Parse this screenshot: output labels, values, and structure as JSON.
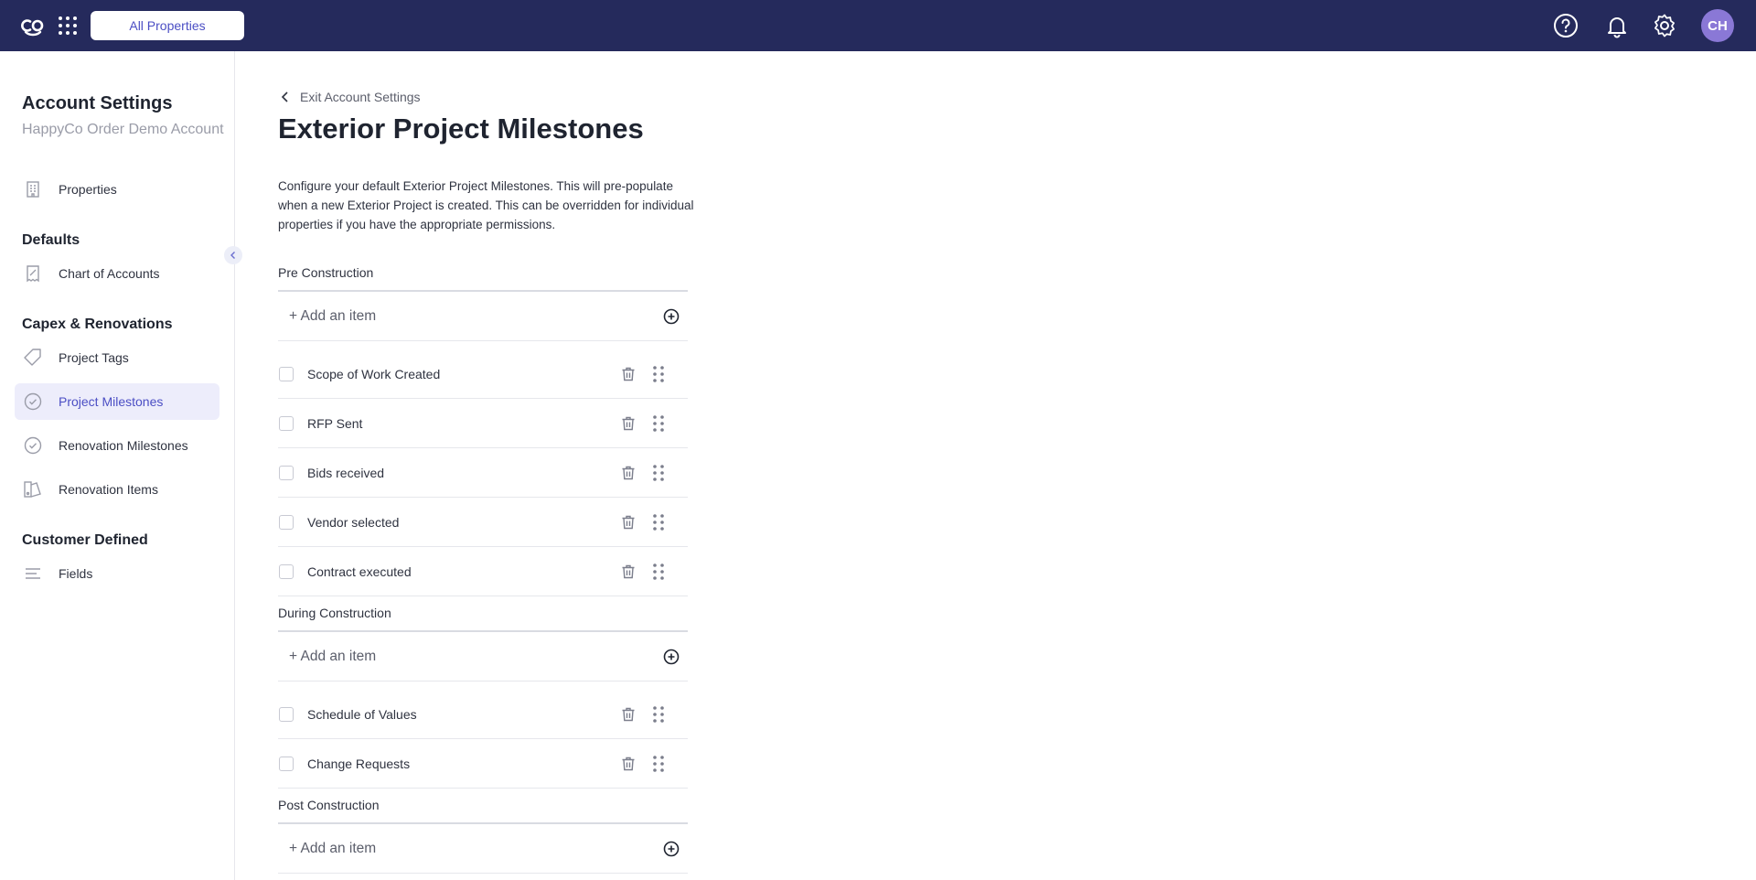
{
  "topbar": {
    "all_properties_label": "All Properties",
    "avatar_initials": "CH",
    "bg_color": "#252a5c",
    "accent_color": "#4b4ec4"
  },
  "sidebar": {
    "title": "Account Settings",
    "subtitle": "HappyCo Order Demo Account",
    "items": [
      {
        "label": "Properties",
        "icon": "building-icon"
      }
    ],
    "sections": [
      {
        "title": "Defaults",
        "items": [
          {
            "label": "Chart of Accounts",
            "icon": "ledger-icon"
          }
        ]
      },
      {
        "title": "Capex & Renovations",
        "items": [
          {
            "label": "Project Tags",
            "icon": "tag-icon"
          },
          {
            "label": "Project Milestones",
            "icon": "check-circle-icon",
            "active": true
          },
          {
            "label": "Renovation Milestones",
            "icon": "check-circle-icon"
          },
          {
            "label": "Renovation Items",
            "icon": "paint-icon"
          }
        ]
      },
      {
        "title": "Customer Defined",
        "items": [
          {
            "label": "Fields",
            "icon": "fields-icon"
          }
        ]
      }
    ]
  },
  "main": {
    "back_label": "Exit Account Settings",
    "title": "Exterior Project Milestones",
    "description": "Configure your default Exterior Project Milestones. This will pre-populate when a new Exterior Project is created. This can be overridden for individual properties if you have the appropriate permissions.",
    "add_item_label": "+ Add an item",
    "groups": [
      {
        "label": "Pre Construction",
        "items": [
          "Scope of Work Created",
          "RFP Sent",
          "Bids received",
          "Vendor selected",
          "Contract executed"
        ]
      },
      {
        "label": "During Construction",
        "items": [
          "Schedule of Values",
          "Change Requests"
        ]
      },
      {
        "label": "Post Construction",
        "items": []
      }
    ]
  }
}
